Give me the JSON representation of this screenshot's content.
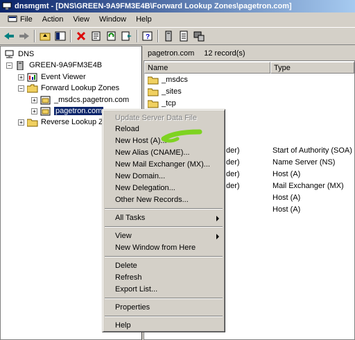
{
  "window": {
    "title": "dnsmgmt - [DNS\\GREEN-9A9FM3E4B\\Forward Lookup Zones\\pagetron.com]"
  },
  "menubar": {
    "items": [
      "File",
      "Action",
      "View",
      "Window",
      "Help"
    ]
  },
  "tree": {
    "root": "DNS",
    "server": "GREEN-9A9FM3E4B",
    "event_viewer": "Event Viewer",
    "forward_zones": "Forward Lookup Zones",
    "zone1": "_msdcs.pagetron.com",
    "zone2": "pagetron.com",
    "reverse_zones": "Reverse Lookup Zo"
  },
  "right": {
    "zone": "pagetron.com",
    "records": "12 record(s)",
    "columns": [
      "Name",
      "Type"
    ],
    "folders": [
      "_msdcs",
      "_sites",
      "_tcp"
    ],
    "rows": [
      {
        "name": "der)",
        "type": "Start of Authority (SOA)"
      },
      {
        "name": "der)",
        "type": "Name Server (NS)"
      },
      {
        "name": "der)",
        "type": "Host (A)"
      },
      {
        "name": "der)",
        "type": "Mail Exchanger (MX)"
      },
      {
        "name": "",
        "type": "Host (A)"
      },
      {
        "name": "",
        "type": "Host (A)"
      }
    ]
  },
  "context_menu": {
    "update": "Update Server Data File",
    "reload": "Reload",
    "new_host": "New Host (A)...",
    "new_alias": "New Alias (CNAME)...",
    "new_mx": "New Mail Exchanger (MX)...",
    "new_domain": "New Domain...",
    "new_delegation": "New Delegation...",
    "other_records": "Other New Records...",
    "all_tasks": "All Tasks",
    "view": "View",
    "new_window": "New Window from Here",
    "delete": "Delete",
    "refresh": "Refresh",
    "export": "Export List...",
    "properties": "Properties",
    "help": "Help"
  },
  "colors": {
    "highlight": "#0a246a",
    "annotation": "#7ed321"
  }
}
